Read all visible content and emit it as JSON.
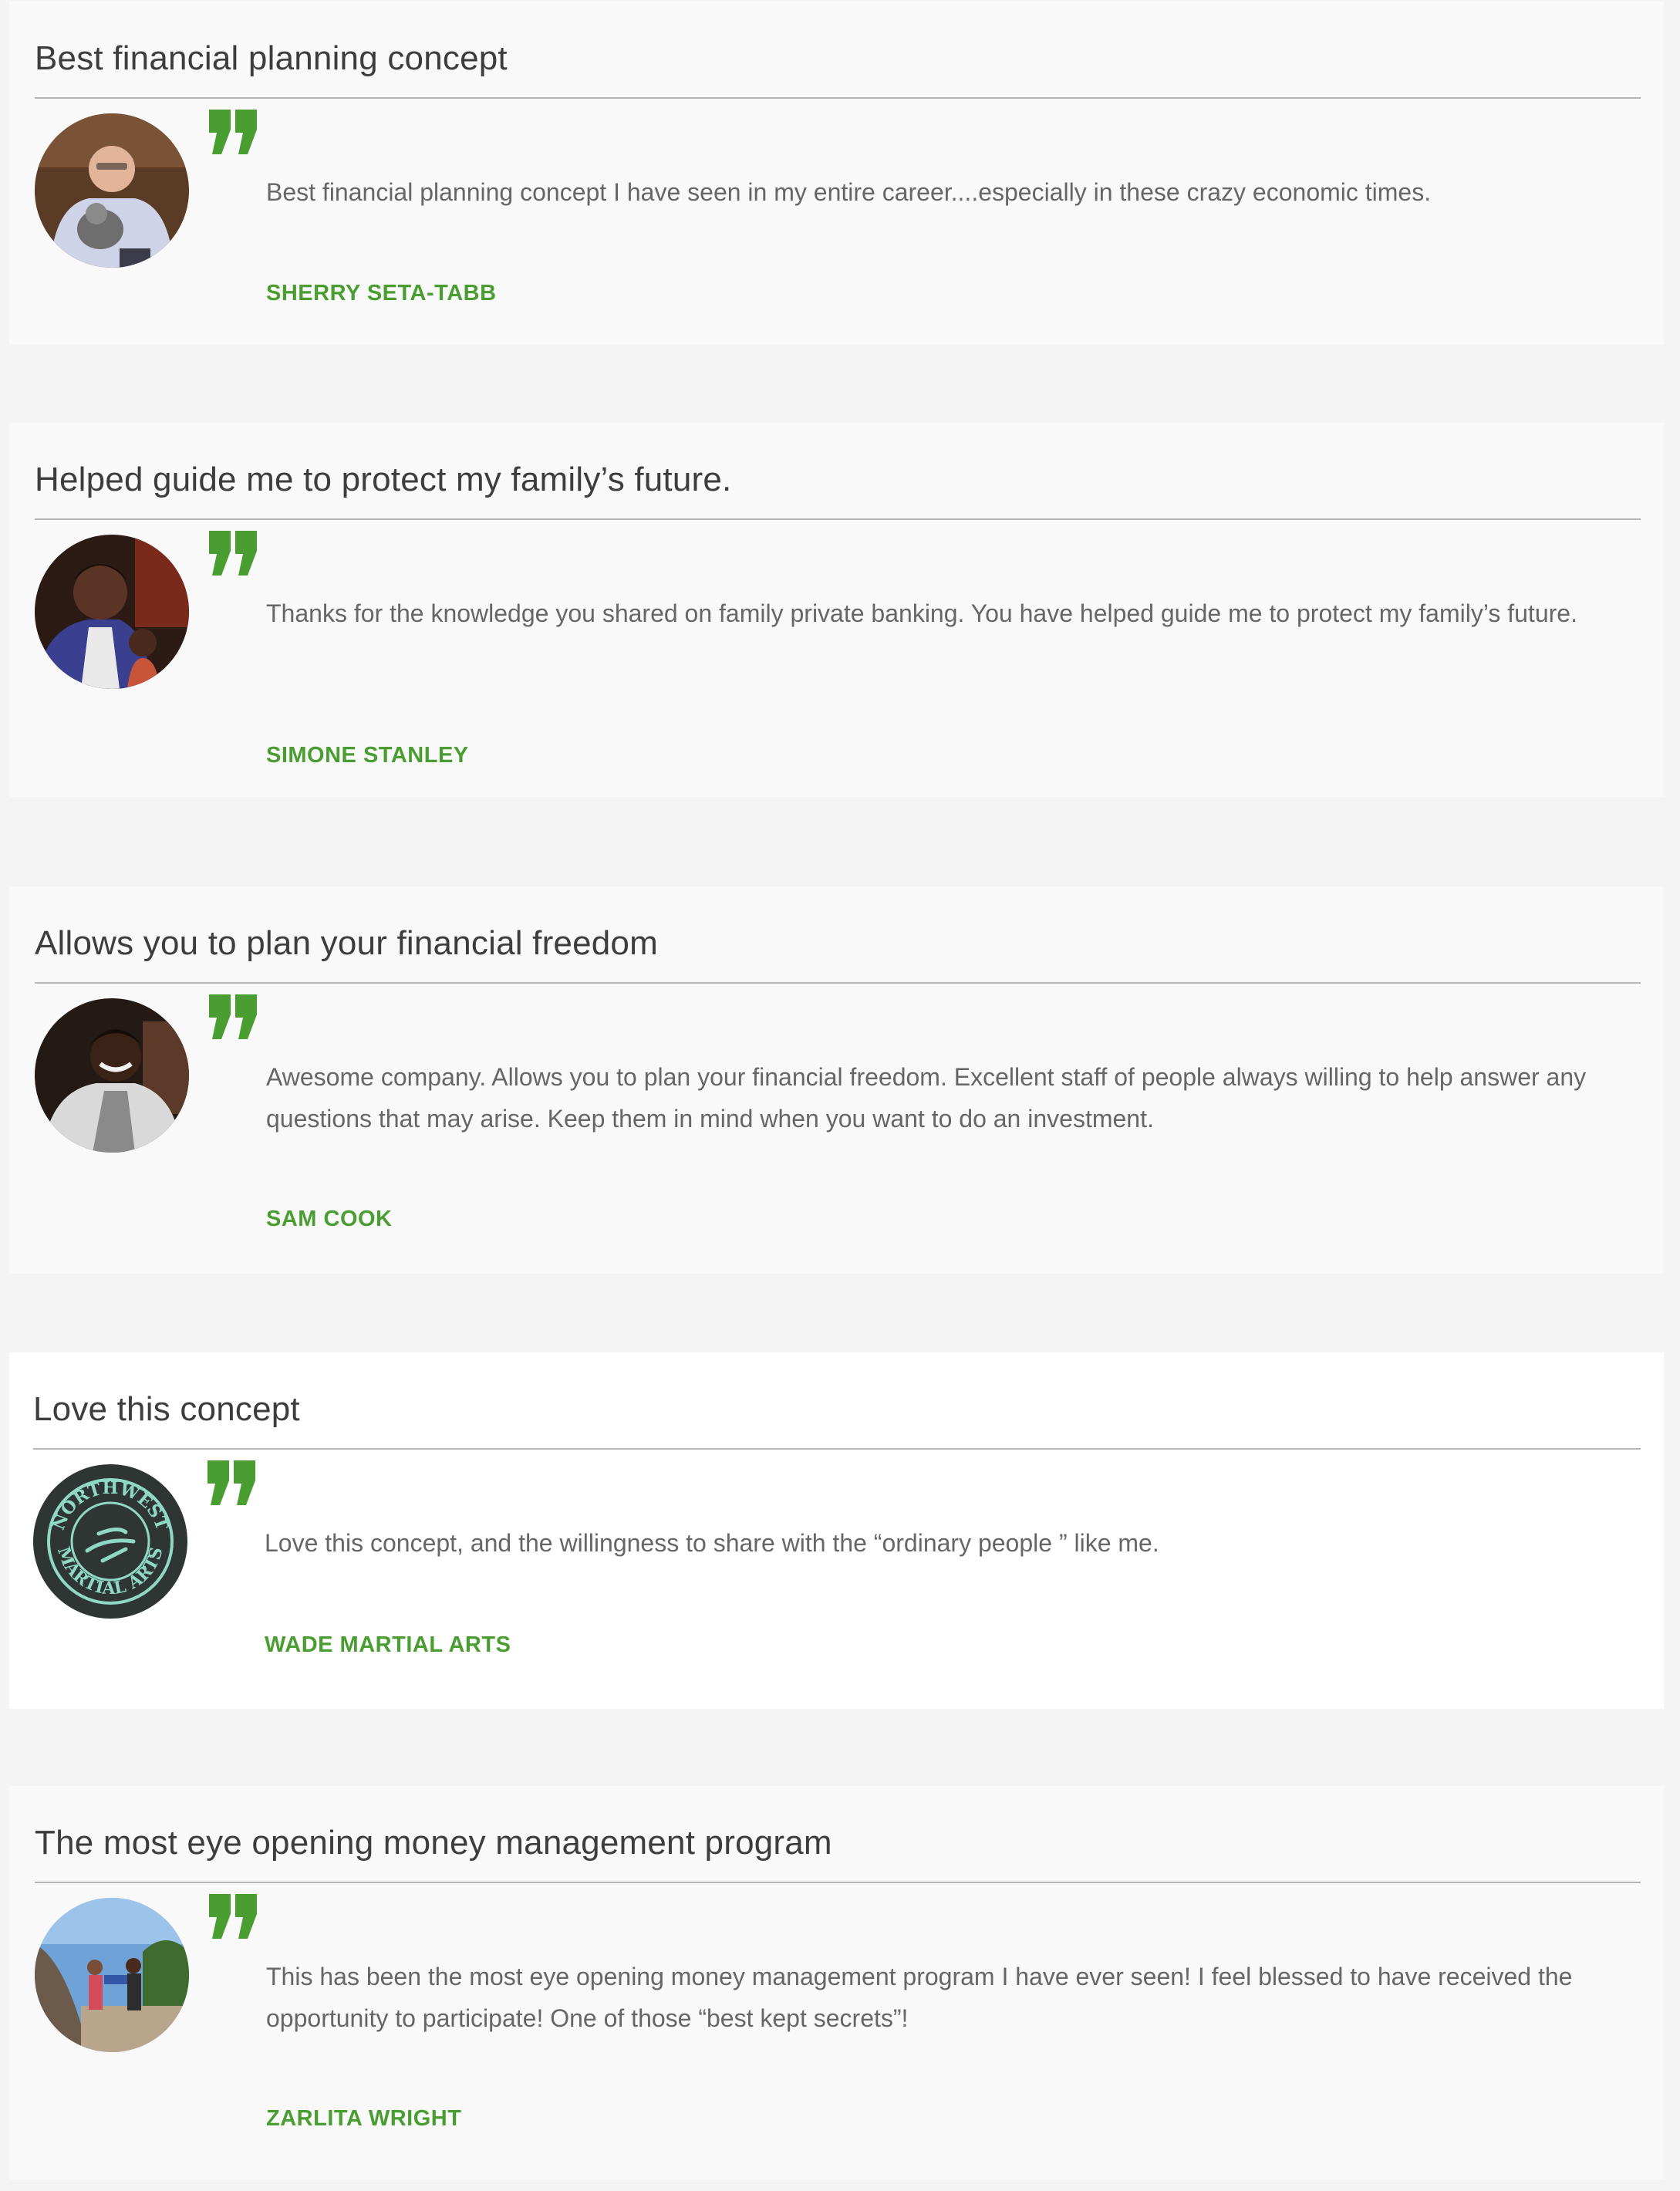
{
  "accent_color": "#4a9e31",
  "testimonials": [
    {
      "title": "Best financial planning concept",
      "text": "Best financial planning concept I have seen in my entire career....especially in these crazy economic times.",
      "author": "SHERRY SETA-TABB",
      "avatar_icon": "person-with-dog-photo"
    },
    {
      "title": "Helped guide me to protect my family’s future.",
      "text": "Thanks for the knowledge you shared on family private banking. You have helped guide me to protect my family’s future.",
      "author": "SIMONE STANLEY",
      "avatar_icon": "woman-and-child-photo"
    },
    {
      "title": "Allows you to plan your financial freedom",
      "text": "Awesome company. Allows you to plan your financial freedom. Excellent staff of people always willing to help answer any questions that may arise. Keep them in mind when you want to do an investment.",
      "author": "SAM COOK",
      "avatar_icon": "smiling-man-photo"
    },
    {
      "title": "Love this concept",
      "text": "Love this concept, and the willingness to share with the “ordinary people ” like me.",
      "author": "WADE MARTIAL ARTS",
      "avatar_icon": "martial-arts-logo",
      "logo_text_top": "NORTHWEST",
      "logo_text_bottom": "MARTIAL ARTS"
    },
    {
      "title": "The most eye opening money management program",
      "text": "This has been the most eye opening money management program I have ever seen! I feel blessed to have received the opportunity to participate! One of those “best kept secrets”!",
      "author": "ZARLITA WRIGHT",
      "avatar_icon": "outdoor-hikers-photo"
    }
  ]
}
